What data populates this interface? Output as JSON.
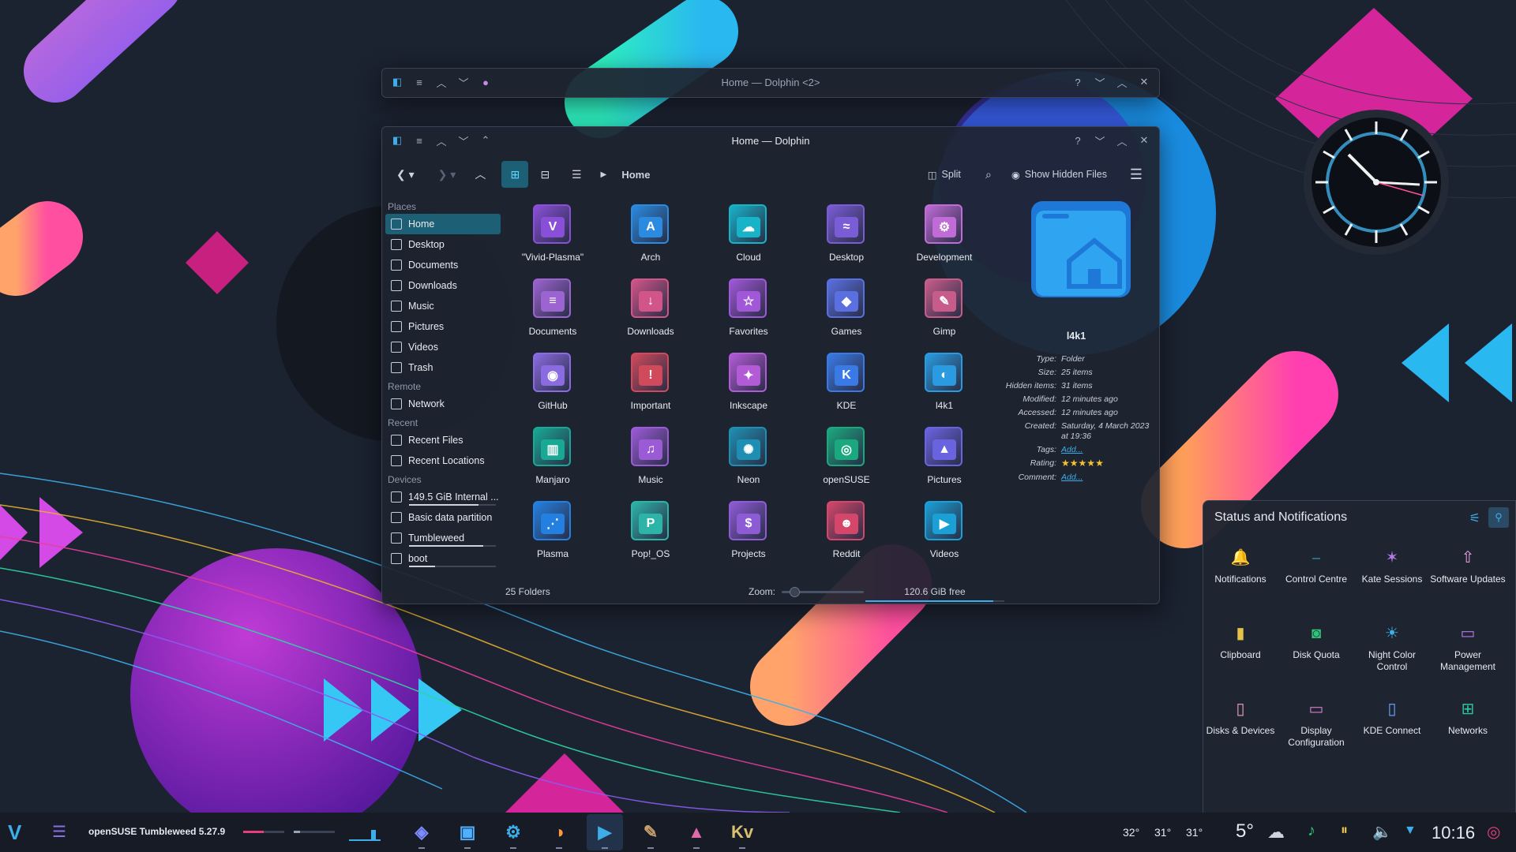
{
  "colors": {
    "accent": "#3daee9",
    "selection": "#1d5f74",
    "window_bg": "#1e2430",
    "desktop_bg": "#1b2230"
  },
  "window_back": {
    "title": "Home — Dolphin <2>"
  },
  "dolphin": {
    "title": "Home — Dolphin",
    "toolbar": {
      "breadcrumb": "Home",
      "split_label": "Split",
      "show_hidden_label": "Show Hidden Files"
    },
    "places": {
      "header": "Places",
      "items": [
        {
          "label": "Home",
          "icon": "home-icon"
        },
        {
          "label": "Desktop",
          "icon": "desktop-icon"
        },
        {
          "label": "Documents",
          "icon": "documents-icon"
        },
        {
          "label": "Downloads",
          "icon": "downloads-icon"
        },
        {
          "label": "Music",
          "icon": "music-icon"
        },
        {
          "label": "Pictures",
          "icon": "pictures-icon"
        },
        {
          "label": "Videos",
          "icon": "videos-icon"
        },
        {
          "label": "Trash",
          "icon": "trash-icon"
        }
      ]
    },
    "remote": {
      "header": "Remote",
      "items": [
        {
          "label": "Network",
          "icon": "network-icon"
        }
      ]
    },
    "recent": {
      "header": "Recent",
      "items": [
        {
          "label": "Recent Files",
          "icon": "recent-files-icon"
        },
        {
          "label": "Recent Locations",
          "icon": "recent-locations-icon"
        }
      ]
    },
    "devices": {
      "header": "Devices",
      "items": [
        {
          "label": "149.5 GiB Internal ...",
          "icon": "drive-icon",
          "usage": 0.8
        },
        {
          "label": "Basic data partition",
          "icon": "drive-icon"
        },
        {
          "label": "Tumbleweed",
          "icon": "drive-icon",
          "usage": 0.85
        },
        {
          "label": "boot",
          "icon": "drive-icon",
          "usage": 0.3
        }
      ]
    },
    "folders": [
      {
        "name": "\"Vivid-Plasma\"",
        "color": "#8a4fd8",
        "glyph": "V"
      },
      {
        "name": "Arch",
        "color": "#2a8be0",
        "glyph": "A"
      },
      {
        "name": "Cloud",
        "color": "#17b3c9",
        "glyph": "☁"
      },
      {
        "name": "Desktop",
        "color": "#7a5cd6",
        "glyph": "≈"
      },
      {
        "name": "Development",
        "color": "#c06bd6",
        "glyph": "⚙"
      },
      {
        "name": "Documents",
        "color": "#9b64d0",
        "glyph": "≡"
      },
      {
        "name": "Downloads",
        "color": "#d2558a",
        "glyph": "↓"
      },
      {
        "name": "Favorites",
        "color": "#a057d8",
        "glyph": "☆"
      },
      {
        "name": "Games",
        "color": "#5a6fe0",
        "glyph": "◆"
      },
      {
        "name": "Gimp",
        "color": "#c75c8a",
        "glyph": "✎"
      },
      {
        "name": "GitHub",
        "color": "#8a6be0",
        "glyph": "◉"
      },
      {
        "name": "Important",
        "color": "#d04a5c",
        "glyph": "!"
      },
      {
        "name": "Inkscape",
        "color": "#b35ad6",
        "glyph": "✦"
      },
      {
        "name": "KDE",
        "color": "#3a7ae6",
        "glyph": "K"
      },
      {
        "name": "l4k1",
        "color": "#2a9be0",
        "glyph": "◐"
      },
      {
        "name": "Manjaro",
        "color": "#18a994",
        "glyph": "▥"
      },
      {
        "name": "Music",
        "color": "#9b5bd6",
        "glyph": "♫"
      },
      {
        "name": "Neon",
        "color": "#1e8fb3",
        "glyph": "✺"
      },
      {
        "name": "openSUSE",
        "color": "#1aa87e",
        "glyph": "◎"
      },
      {
        "name": "Pictures",
        "color": "#6a63e0",
        "glyph": "▲"
      },
      {
        "name": "Plasma",
        "color": "#2480e0",
        "glyph": "⋰"
      },
      {
        "name": "Pop!_OS",
        "color": "#2db4a8",
        "glyph": "P"
      },
      {
        "name": "Projects",
        "color": "#8e5bd6",
        "glyph": "$"
      },
      {
        "name": "Reddit",
        "color": "#d4466a",
        "glyph": "☻"
      },
      {
        "name": "Videos",
        "color": "#1a9fd6",
        "glyph": "▶"
      }
    ],
    "details": {
      "name": "l4k1",
      "rows": [
        {
          "k": "Type:",
          "v": "Folder"
        },
        {
          "k": "Size:",
          "v": "25 items"
        },
        {
          "k": "Hidden items:",
          "v": "31 items"
        },
        {
          "k": "Modified:",
          "v": "12 minutes ago"
        },
        {
          "k": "Accessed:",
          "v": "12 minutes ago"
        },
        {
          "k": "Created:",
          "v": "Saturday, 4 March 2023 at 19:36"
        }
      ],
      "tags_label": "Tags:",
      "tags_value": "Add...",
      "rating_label": "Rating:",
      "rating": 5,
      "comment_label": "Comment:",
      "comment_value": "Add..."
    },
    "status": {
      "count": "25 Folders",
      "zoom_label": "Zoom:",
      "zoom": 0.15,
      "free": "120.6 GiB free",
      "free_fraction": 0.92
    }
  },
  "notifications": {
    "title": "Status and Notifications",
    "items": [
      {
        "label": "Notifications",
        "icon": "bell-icon",
        "glyph": "🔔",
        "color": "#c68ae6"
      },
      {
        "label": "Control Centre",
        "icon": "sliders-icon",
        "glyph": "⎯",
        "color": "#3daee9"
      },
      {
        "label": "Kate Sessions",
        "icon": "kate-icon",
        "glyph": "✶",
        "color": "#b779e6"
      },
      {
        "label": "Software Updates",
        "icon": "updates-icon",
        "glyph": "⇧",
        "color": "#e8a0e0"
      },
      {
        "label": "Clipboard",
        "icon": "clipboard-icon",
        "glyph": "▮",
        "color": "#e6c24a"
      },
      {
        "label": "Disk Quota",
        "icon": "disk-quota-icon",
        "glyph": "◙",
        "color": "#2fc47a"
      },
      {
        "label": "Night Color Control",
        "icon": "night-color-icon",
        "glyph": "☀",
        "color": "#3daee9"
      },
      {
        "label": "Power Management",
        "icon": "power-icon",
        "glyph": "▭",
        "color": "#b779e6"
      },
      {
        "label": "Disks & Devices",
        "icon": "disks-icon",
        "glyph": "▯",
        "color": "#e8a0b8"
      },
      {
        "label": "Display Configuration",
        "icon": "display-icon",
        "glyph": "▭",
        "color": "#d080c8"
      },
      {
        "label": "KDE Connect",
        "icon": "kde-connect-icon",
        "glyph": "▯",
        "color": "#6aa6ff"
      },
      {
        "label": "Networks",
        "icon": "networks-icon",
        "glyph": "⊞",
        "color": "#2fc4a0"
      }
    ]
  },
  "taskbar": {
    "os_label": "openSUSE Tumbleweed 5.27.9",
    "temps": [
      "32°",
      "31°",
      "31°"
    ],
    "weather": "5°",
    "clock": "10:16",
    "apps": [
      {
        "name": "app-1-icon",
        "glyph": "◈",
        "color": "#7a8cff"
      },
      {
        "name": "app-2-icon",
        "glyph": "▣",
        "color": "#4fb0ff"
      },
      {
        "name": "settings-app-icon",
        "glyph": "⚙",
        "color": "#3daee9"
      },
      {
        "name": "firefox-icon",
        "glyph": "◑",
        "color": "#ff9a3c"
      },
      {
        "name": "dolphin-app-icon",
        "glyph": "▶",
        "color": "#3daee9"
      },
      {
        "name": "gimp-app-icon",
        "glyph": "✎",
        "color": "#c8a070"
      },
      {
        "name": "image-viewer-icon",
        "glyph": "▲",
        "color": "#e06aa8"
      },
      {
        "name": "kvantum-icon",
        "glyph": "Kv",
        "color": "#d8c070"
      }
    ]
  }
}
